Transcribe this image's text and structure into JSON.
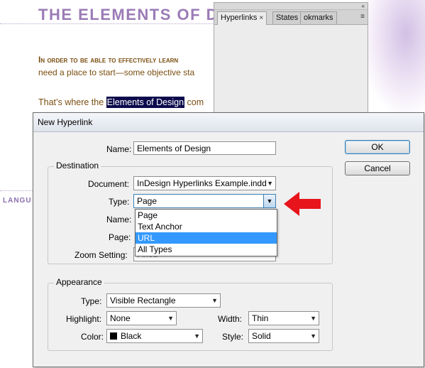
{
  "document": {
    "title": "THE ELEMENTS OF DESIG",
    "line1": "In order to be able to effectively learn",
    "line2": "need a place to start—some objective sta",
    "line3_prefix": "That’s where the ",
    "line3_selected": "Elements of Design",
    "line3_suffix": " com",
    "side_text": "LANGU"
  },
  "panel": {
    "tabs": [
      {
        "label": "Hyperlinks",
        "close": "×"
      },
      {
        "label": "States"
      },
      {
        "label": "okmarks"
      }
    ],
    "menu_glyph": "≡",
    "collapse_glyph": "«"
  },
  "dialog": {
    "title": "New Hyperlink",
    "name_label": "Name:",
    "name_value": "Elements of Design",
    "ok_label": "OK",
    "cancel_label": "Cancel",
    "destination": {
      "group_title": "Destination",
      "document_label": "Document:",
      "document_value": "InDesign Hyperlinks Example.indd",
      "type_label": "Type:",
      "type_value": "Page",
      "name_label": "Name:",
      "page_label": "Page:",
      "zoom_label": "Zoom Setting:",
      "zoom_value": "Fixed"
    },
    "type_options": [
      "Page",
      "Text Anchor",
      "URL",
      "All Types"
    ],
    "appearance": {
      "group_title": "Appearance",
      "type_label": "Type:",
      "type_value": "Visible Rectangle",
      "highlight_label": "Highlight:",
      "highlight_value": "None",
      "color_label": "Color:",
      "color_value": "Black",
      "width_label": "Width:",
      "width_value": "Thin",
      "style_label": "Style:",
      "style_value": "Solid"
    }
  },
  "colors": {
    "title_purple": "#9b7bb7",
    "body_brown": "#7a4e10",
    "selection": "#0b0b4d",
    "highlight_blue": "#3399ff",
    "arrow_red": "#e8141c"
  }
}
